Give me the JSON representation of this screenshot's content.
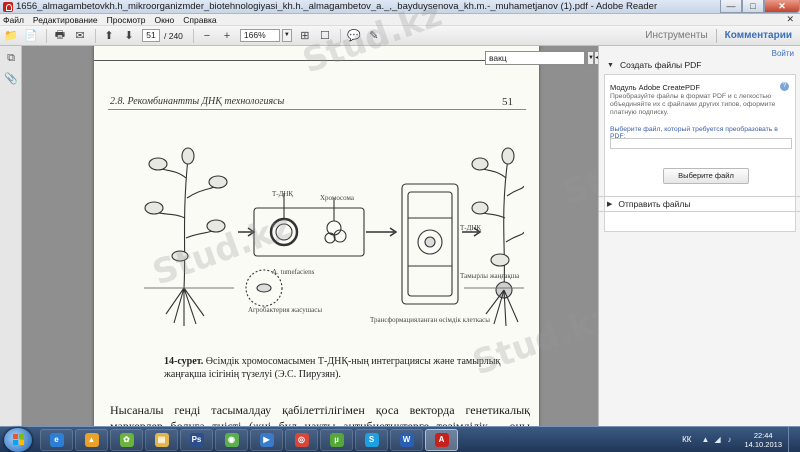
{
  "window": {
    "title": "1656_almagambetovkh.h_mikroorganizmder_biotehnologiyasi_kh.h._almagambetov_a._,_bayduysenova_kh.m.-_muhametjanov (1).pdf - Adobe Reader",
    "minimize": "—",
    "maximize": "□",
    "close": "✕"
  },
  "menu": {
    "items": [
      "Файл",
      "Редактирование",
      "Просмотр",
      "Окно",
      "Справка"
    ],
    "close_glyph": "✕"
  },
  "toolbar": {
    "page_current": "51",
    "page_total": "/ 240",
    "zoom": "166%",
    "zoom_dropdown_glyph": "▼",
    "tools_label": "Инструменты",
    "comments_label": "Комментарии",
    "icons": {
      "open": "📁",
      "create": "📄",
      "print": "🖶",
      "email": "✉",
      "up": "⬆",
      "down": "⬇",
      "zoom_out": "−",
      "zoom_in": "+",
      "fit": "⊞",
      "read": "☐",
      "comment": "💬",
      "sign": "✎"
    }
  },
  "left_nav": {
    "icons": {
      "pages": "⧉",
      "attachments": "📎"
    }
  },
  "search": {
    "value": "вакц",
    "prev_glyph": "◀",
    "next_glyph": "▶",
    "dropdown_glyph": "▼"
  },
  "document": {
    "header_title": "2.8. Рекомбинантты ДНҚ технологиясы",
    "page_number": "51",
    "figure_labels": {
      "t_dna": "Т-ДНҚ",
      "chromosome": "Хромосома",
      "agrobacterium": "A. tumefaciens",
      "agrobacterium_cell": "Агробактерия жасушасы",
      "transformed_cell": "Трансформацияланған өсімдік клеткасы",
      "t_dna_right": "Т-ДНҚ",
      "hairy_root": "Тамырлы жаңғақша"
    },
    "caption_label": "14-сурет.",
    "caption_text": " Өсімдік хромосомасымен Т-ДНҚ-ның интеграциясы және тамырлық жаңғақша ісігінің түзелуі (Э.С. Пирузян).",
    "body_text": "Нысаналы генді тасымалдау қабілеттілігімен қоса векторда генетикалық маркерлер болуға тиісті (жиі бұл нақты антибиотиктерге төзімділік – оны селективті қоректік ортаға себу қорытындысы бойынша трансформацияланған клеткаларды іріктеуге мүмкіндік береді."
  },
  "watermark": "Stud.kz",
  "right_panel": {
    "login": "Войти",
    "create_pdf_title": "Создать файлы PDF",
    "module_heading": "Модуль Adobe CreatePDF",
    "help_glyph": "?",
    "module_desc": "Преобразуйте файлы в формат PDF и с легкостью объединяйте их с файлами других типов, оформите платную подписку.",
    "select_label": "Выберите файл, который требуется преобразовать в PDF:",
    "select_button": "Выберите файл",
    "send_files_title": "Отправить файлы",
    "expanded_arrow": "▼",
    "collapsed_arrow": "▶"
  },
  "taskbar": {
    "apps": [
      {
        "name": "ie",
        "glyph": "e",
        "color": "#2d7fd6"
      },
      {
        "name": "avast",
        "glyph": "▲",
        "color": "#e8a12a"
      },
      {
        "name": "icq",
        "glyph": "✿",
        "color": "#6ab43d"
      },
      {
        "name": "explorer",
        "glyph": "▤",
        "color": "#e0b54a"
      },
      {
        "name": "photoshop",
        "glyph": "Ps",
        "color": "#2c4f8a"
      },
      {
        "name": "chrome-green",
        "glyph": "◉",
        "color": "#5bb04d"
      },
      {
        "name": "media",
        "glyph": "▶",
        "color": "#3a7ac8"
      },
      {
        "name": "chrome",
        "glyph": "◎",
        "color": "#d9473b"
      },
      {
        "name": "utorrent",
        "glyph": "µ",
        "color": "#54a83a"
      },
      {
        "name": "skype",
        "glyph": "S",
        "color": "#1ea0e0"
      },
      {
        "name": "word",
        "glyph": "W",
        "color": "#2b5fb4"
      },
      {
        "name": "adobe-reader",
        "glyph": "A",
        "color": "#c8201c"
      }
    ],
    "lang": "КК",
    "tray_glyphs": [
      "▲",
      "◢",
      "♪"
    ],
    "time": "22:44",
    "date": "14.10.2013"
  }
}
